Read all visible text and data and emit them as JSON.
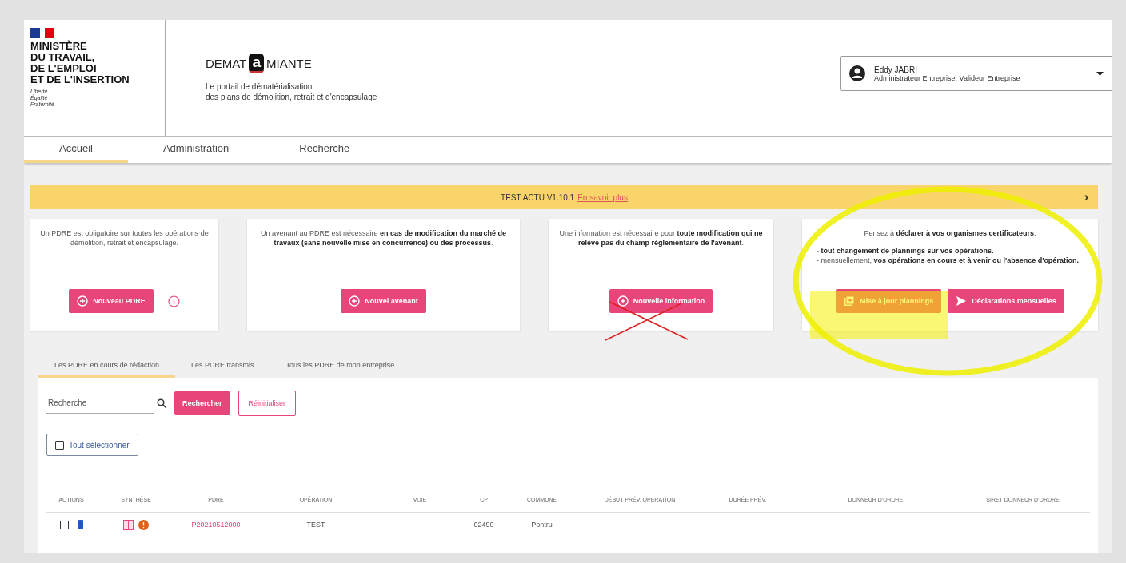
{
  "ministry": {
    "name_lines": [
      "MINISTÈRE",
      "DU TRAVAIL,",
      "DE L'EMPLOI",
      "ET DE L'INSERTION"
    ],
    "motto": [
      "Liberté",
      "Égalité",
      "Fraternité"
    ]
  },
  "app": {
    "logo_before": "DEMAT",
    "logo_mark": "a",
    "logo_after": "MIANTE",
    "tagline": [
      "Le portail de dématérialisation",
      "des plans de démolition, retrait et d'encapsulage"
    ]
  },
  "user": {
    "name": "Eddy JABRI",
    "roles": "Administrateur Entreprise, Valideur Entreprise"
  },
  "nav": [
    {
      "label": "Accueil",
      "selected": true
    },
    {
      "label": "Administration",
      "selected": false
    },
    {
      "label": "Recherche",
      "selected": false
    }
  ],
  "banner": {
    "text": "TEST ACTU V1.10.1",
    "link": "En savoir plus",
    "chevron": "›"
  },
  "cards": [
    {
      "text": "Un PDRE est obligatoire sur toutes les opérations de démolition, retrait et encapsulage.",
      "buttons": [
        {
          "label": "Nouveau PDRE",
          "kind": "plus"
        }
      ],
      "info": true
    },
    {
      "text": "Un avenant au PDRE est nécessaire **en cas de modification du marché de travaux (sans nouvelle mise en concurrence) ou des processus**.",
      "buttons": [
        {
          "label": "Nouvel avenant",
          "kind": "plus"
        }
      ]
    },
    {
      "text": "Une information est nécessaire pour **toute modification qui ne relève pas du champ réglementaire de l'avenant**.",
      "buttons": [
        {
          "label": "Nouvelle information",
          "kind": "plus"
        }
      ]
    },
    {
      "text": "Pensez à **déclarer à vos organismes certificateurs**:",
      "bullets": [
        "- **tout changement de plannings sur vos opérations.**",
        "- mensuellement, **vos opérations en cours et à venir ou l'absence d'opération.**"
      ],
      "buttons": [
        {
          "label": "Mise à jour plannings",
          "kind": "calendar"
        },
        {
          "label": "Déclarations mensuelles",
          "kind": "send"
        }
      ]
    }
  ],
  "subtabs": [
    {
      "label": "Les PDRE en cours de rédaction",
      "selected": true
    },
    {
      "label": "Les PDRE transmis",
      "selected": false
    },
    {
      "label": "Tous les PDRE de mon entreprise",
      "selected": false
    }
  ],
  "search": {
    "placeholder": "Recherche",
    "submit": "Rechercher",
    "reset": "Réinitialiser"
  },
  "select_all": {
    "label": "Tout sélectionner",
    "checked": false
  },
  "table": {
    "columns": [
      "ACTIONS",
      "SYNTHÈSE",
      "PDRE",
      "OPÉRATION",
      "VOIE",
      "CP",
      "COMMUNE",
      "DÉBUT PRÉV. OPÉRATION",
      "DURÉE PRÉV.",
      "DONNEUR D'ORDRE",
      "SIRET DONNEUR D'ORDRE"
    ],
    "rows": [
      {
        "checked": false,
        "pdre": "P20210512000",
        "operation": "TEST",
        "cp": "02490",
        "commune": "Pontru"
      }
    ]
  }
}
